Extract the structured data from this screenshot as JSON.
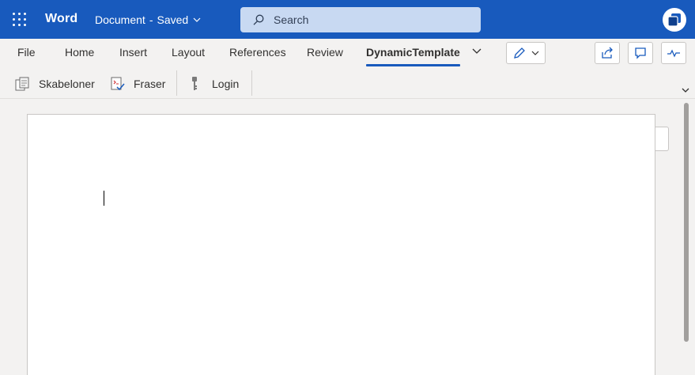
{
  "app": {
    "name": "Word",
    "document_title": "Document",
    "separator": "-",
    "save_status": "Saved"
  },
  "search": {
    "placeholder": "Search"
  },
  "tabs": [
    {
      "label": "File"
    },
    {
      "label": "Home"
    },
    {
      "label": "Insert"
    },
    {
      "label": "Layout"
    },
    {
      "label": "References"
    },
    {
      "label": "Review"
    },
    {
      "label": "DynamicTemplate",
      "active": true
    }
  ],
  "ribbon": {
    "commands": [
      {
        "label": "Skabeloner",
        "icon": "templates-icon"
      },
      {
        "label": "Fraser",
        "icon": "phrases-icon"
      },
      {
        "label": "Login",
        "icon": "key-icon"
      }
    ]
  },
  "colors": {
    "brand": "#185abd",
    "search_bg": "#c8d9f2",
    "ribbon_bg": "#f3f2f1",
    "active_underline": "#185abd"
  },
  "icons": {
    "app_launcher": "waffle-icon",
    "search": "search-icon",
    "account": "teams-icon",
    "editing": "pencil-icon",
    "share": "share-icon",
    "comments": "comment-icon",
    "activity": "activity-icon"
  }
}
